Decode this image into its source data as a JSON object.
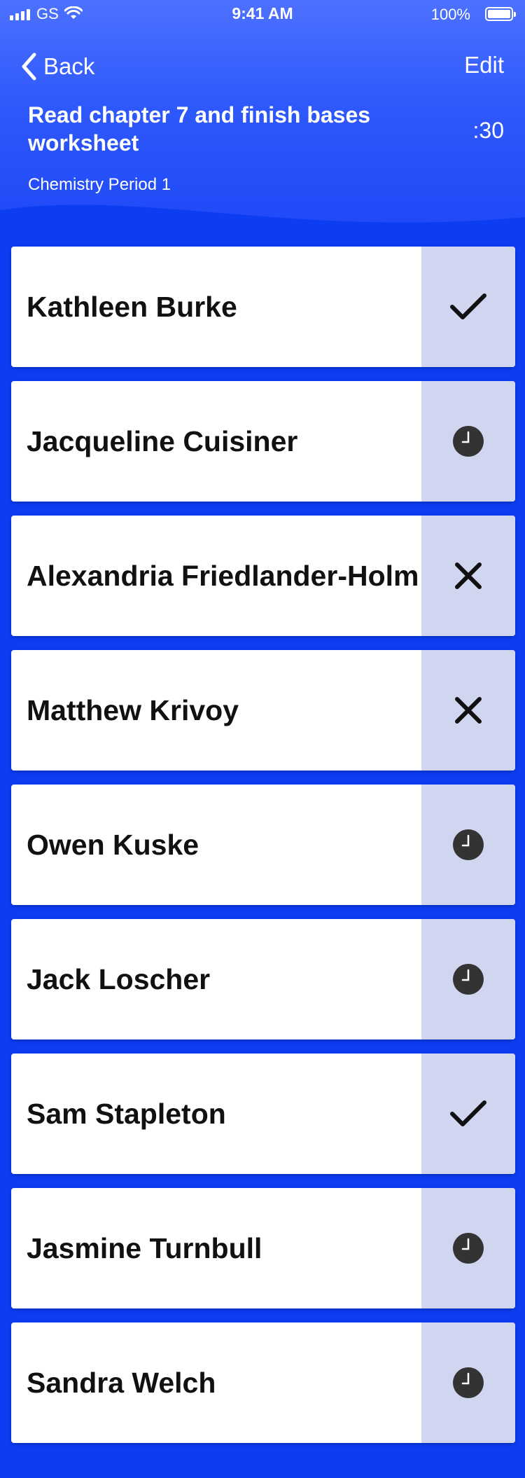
{
  "status_bar": {
    "carrier": "GS",
    "time": "9:41 AM",
    "battery": "100%"
  },
  "nav": {
    "back_label": "Back",
    "edit_label": "Edit"
  },
  "assignment": {
    "title": "Read chapter 7 and finish bases worksheet",
    "timer": ":30",
    "class_name": "Chemistry Period 1"
  },
  "colors": {
    "header_top": "#4d71ff",
    "background": "#0d3df0",
    "status_cell": "#d0d5f0"
  },
  "students": [
    {
      "name": "Kathleen Burke",
      "status": "done",
      "icon": "check-icon"
    },
    {
      "name": "Jacqueline Cuisiner",
      "status": "pending",
      "icon": "clock-icon"
    },
    {
      "name": "Alexandria Friedlander-Holm",
      "status": "missing",
      "icon": "x-icon"
    },
    {
      "name": "Matthew Krivoy",
      "status": "missing",
      "icon": "x-icon"
    },
    {
      "name": "Owen Kuske",
      "status": "pending",
      "icon": "clock-icon"
    },
    {
      "name": "Jack Loscher",
      "status": "pending",
      "icon": "clock-icon"
    },
    {
      "name": "Sam Stapleton",
      "status": "done",
      "icon": "check-icon"
    },
    {
      "name": "Jasmine Turnbull",
      "status": "pending",
      "icon": "clock-icon"
    },
    {
      "name": "Sandra Welch",
      "status": "pending",
      "icon": "clock-icon"
    }
  ]
}
